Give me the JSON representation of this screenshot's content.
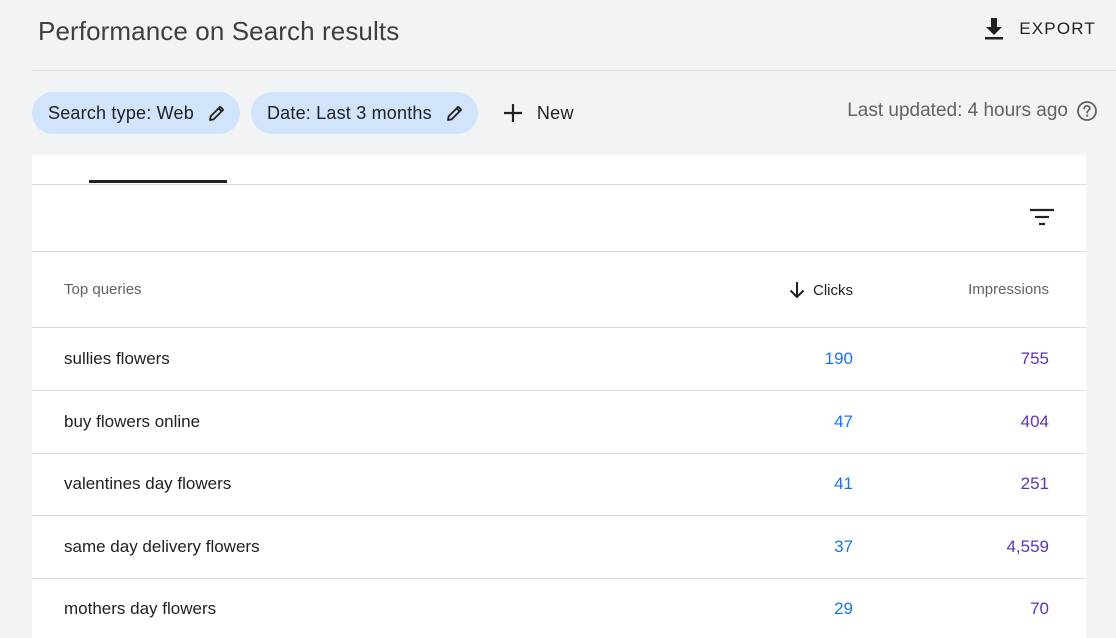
{
  "header": {
    "title": "Performance on Search results",
    "export_label": "EXPORT",
    "export_icon": "download-icon"
  },
  "filters": {
    "chips": [
      {
        "label": "Search type: Web",
        "icon": "edit-pencil-icon"
      },
      {
        "label": "Date: Last 3 months",
        "icon": "edit-pencil-icon"
      }
    ],
    "new_label": "New",
    "new_icon": "plus-icon"
  },
  "last_updated": {
    "text": "Last updated: 4 hours ago",
    "icon": "help-circle-icon"
  },
  "table": {
    "columns": {
      "queries": "Top queries",
      "clicks": "Clicks",
      "impressions": "Impressions"
    },
    "sort_icon": "arrow-down-icon",
    "rows": [
      {
        "query": "sullies flowers",
        "clicks": "190",
        "impressions": "755"
      },
      {
        "query": "buy flowers online",
        "clicks": "47",
        "impressions": "404"
      },
      {
        "query": "valentines day flowers",
        "clicks": "41",
        "impressions": "251"
      },
      {
        "query": "same day delivery flowers",
        "clicks": "37",
        "impressions": "4,559"
      },
      {
        "query": "mothers day flowers",
        "clicks": "29",
        "impressions": "70"
      }
    ]
  },
  "colors": {
    "clicks": "#1a73e8",
    "impressions": "#5e35b1",
    "chip_bg": "#d2e3fc",
    "page_bg": "#f1f3f4"
  }
}
